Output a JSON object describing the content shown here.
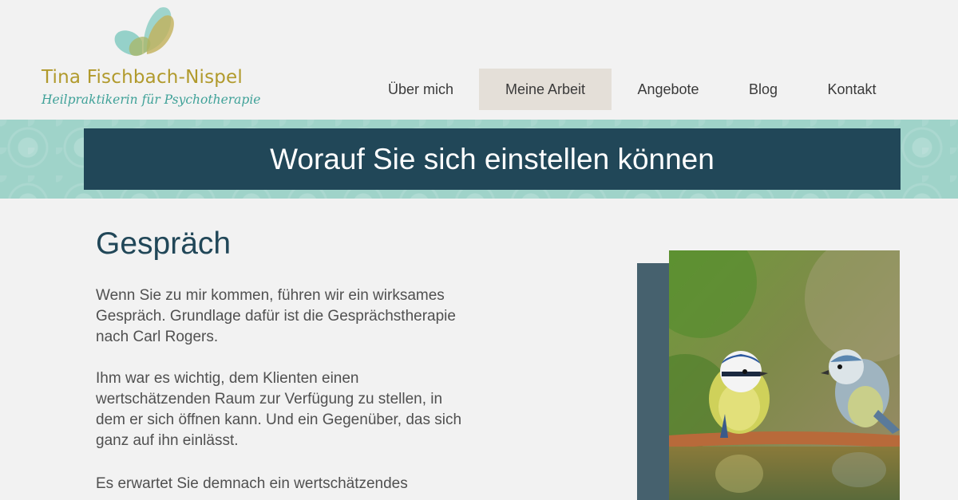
{
  "brand": {
    "name": "Tina Fischbach-Nispel",
    "subtitle": "Heilpraktikerin für Psychotherapie"
  },
  "nav": {
    "items": [
      {
        "label": "Über mich",
        "active": false
      },
      {
        "label": "Meine Arbeit",
        "active": true
      },
      {
        "label": "Angebote",
        "active": false
      },
      {
        "label": "Blog",
        "active": false
      },
      {
        "label": "Kontakt",
        "active": false
      }
    ]
  },
  "banner": {
    "title": "Worauf Sie sich einstellen können"
  },
  "content": {
    "heading": "Gespräch",
    "paragraphs": [
      "Wenn Sie zu mir kommen, führen wir ein wirksames Gespräch. Grundlage dafür ist die Gesprächstherapie nach Carl Rogers.",
      "Ihm war es wichtig, dem Klienten einen wertschätzenden Raum zur Verfügung zu stellen, in dem er sich öffnen kann. Und ein Gegenüber, das sich ganz auf ihn einlässt.",
      "Es erwartet Sie demnach ein wertschätzendes"
    ]
  },
  "colors": {
    "banner_bg": "#214758",
    "brand_gold": "#b19a2c",
    "brand_teal": "#3fa198",
    "nav_active_bg": "#e4dfd8",
    "pattern_mint": "#9fd3c9",
    "accent_block": "#46616e"
  },
  "icons": {
    "logo": "butterfly-logo-icon"
  }
}
